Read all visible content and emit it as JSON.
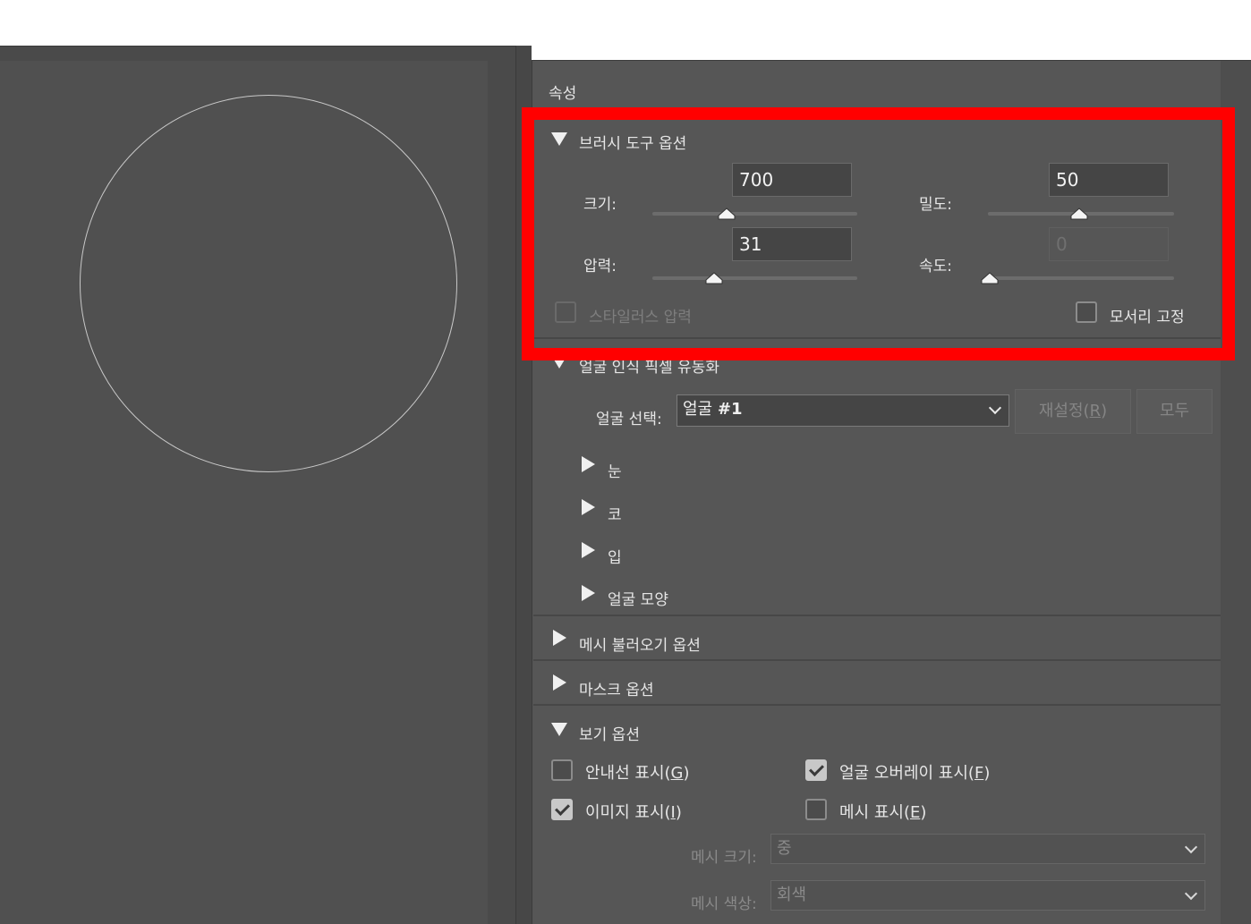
{
  "panel": {
    "title": "속성"
  },
  "brush_options": {
    "header": "브러시 도구 옵션",
    "size": {
      "label": "크기:",
      "value": "700",
      "level": 0.36
    },
    "density": {
      "label": "밀도:",
      "value": "50",
      "level": 0.5
    },
    "pressure": {
      "label": "압력:",
      "value": "31",
      "level": 0.31
    },
    "rate": {
      "label": "속도:",
      "value": "0",
      "level": 0.0
    },
    "stylus_pressure": "스타일러스 압력",
    "pin_edges": "모서리 고정"
  },
  "face_liquify": {
    "header": "얼굴 인식 픽셀 유동화",
    "select_label": "얼굴 선택:",
    "select_value_prefix": "얼굴",
    "select_value_num": "#1",
    "reset_label": "재설정(",
    "reset_key": "R",
    "reset_close": ")",
    "all_label": "모두",
    "groups": [
      "눈",
      "코",
      "입",
      "얼굴 모양"
    ]
  },
  "mesh_load": {
    "header": "메시 불러오기 옵션"
  },
  "mask": {
    "header": "마스크 옵션"
  },
  "view": {
    "header": "보기 옵션",
    "show_guides": {
      "label": "안내선 표시(",
      "key": "G",
      "checked": false
    },
    "face_overlay": {
      "label": "얼굴 오버레이 표시(",
      "key": "F",
      "checked": true
    },
    "show_image": {
      "label": "이미지 표시(",
      "key": "I",
      "checked": true
    },
    "show_mesh": {
      "label": "메시 표시(",
      "key": "E",
      "checked": false
    },
    "mesh_size_label": "메시 크기:",
    "mesh_size_value": "중",
    "mesh_color_label": "메시 색상:",
    "mesh_color_value": "회색"
  },
  "close_paren": ")",
  "colors": {
    "highlight": "#ff0000",
    "panel_bg": "#565656",
    "canvas_bg": "#505050"
  }
}
